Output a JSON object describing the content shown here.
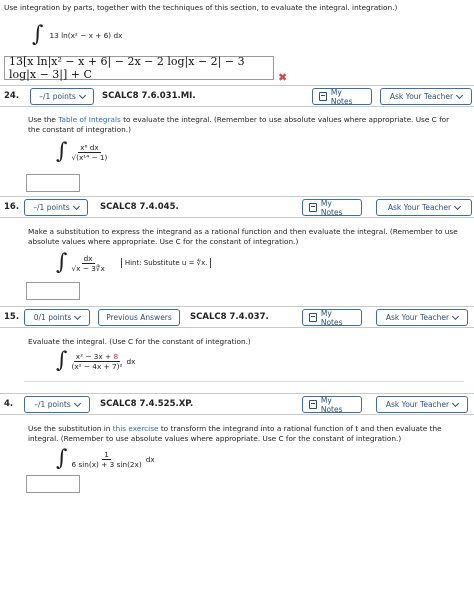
{
  "top": {
    "instruction": "Use integration by parts, together with the techniques of this section, to evaluate the integral. integration.)",
    "integrand": "13 ln(x² − x + 6) dx",
    "submitted_answer": "13[x ln|x² − x + 6| − 2x − 2 log|x − 2| − 3 log|x − 3|] + C"
  },
  "questions": [
    {
      "number": "24.",
      "points": "–/1 points",
      "code": "SCALC8 7.6.031.MI.",
      "my_notes": "My Notes",
      "ask": "Ask Your Teacher",
      "prompt_pre": "Use the ",
      "prompt_link": "Table of Integrals",
      "prompt_post": " to evaluate the integral. (Remember to use absolute values where appropriate. Use C for the constant of integration.)",
      "num": "x⁶ dx",
      "den": "√(x¹⁴ − 1)"
    },
    {
      "number": "16.",
      "points": "–/1 points",
      "code": "SCALC8 7.4.045.",
      "my_notes": "My Notes",
      "ask": "Ask Your Teacher",
      "prompt": "Make a substitution to express the integrand as a rational function and then evaluate the integral. (Remember to use absolute values where appropriate. Use C for the constant of integration.)",
      "num": "dx",
      "den": "√x − 3∜x",
      "hint": "Hint: Substitute u = ∜x."
    },
    {
      "number": "15.",
      "points": "0/1 points",
      "prev": "Previous Answers",
      "code": "SCALC8 7.4.037.",
      "my_notes": "My Notes",
      "ask": "Ask Your Teacher",
      "prompt": "Evaluate the integral. (Use C for the constant of integration.)",
      "num_black": "x² − 3x + ",
      "num_red": "8",
      "den": "(x² − 4x + 7)²"
    },
    {
      "number": "4.",
      "points": "–/1 points",
      "code": "SCALC8 7.4.525.XP.",
      "my_notes": "My Notes",
      "ask": "Ask Your Teacher",
      "prompt_pre": "Use the substitution in ",
      "prompt_link": "this exercise",
      "prompt_post": " to transform the integrand into a rational function of t and then evaluate the integral. (Remember to use absolute values where appropriate. Use C for the constant of integration.)",
      "num": "1",
      "den": "6 sin(x) + 3 sin(2x)"
    }
  ],
  "common": {
    "dx": "dx",
    "integral": "∫"
  }
}
